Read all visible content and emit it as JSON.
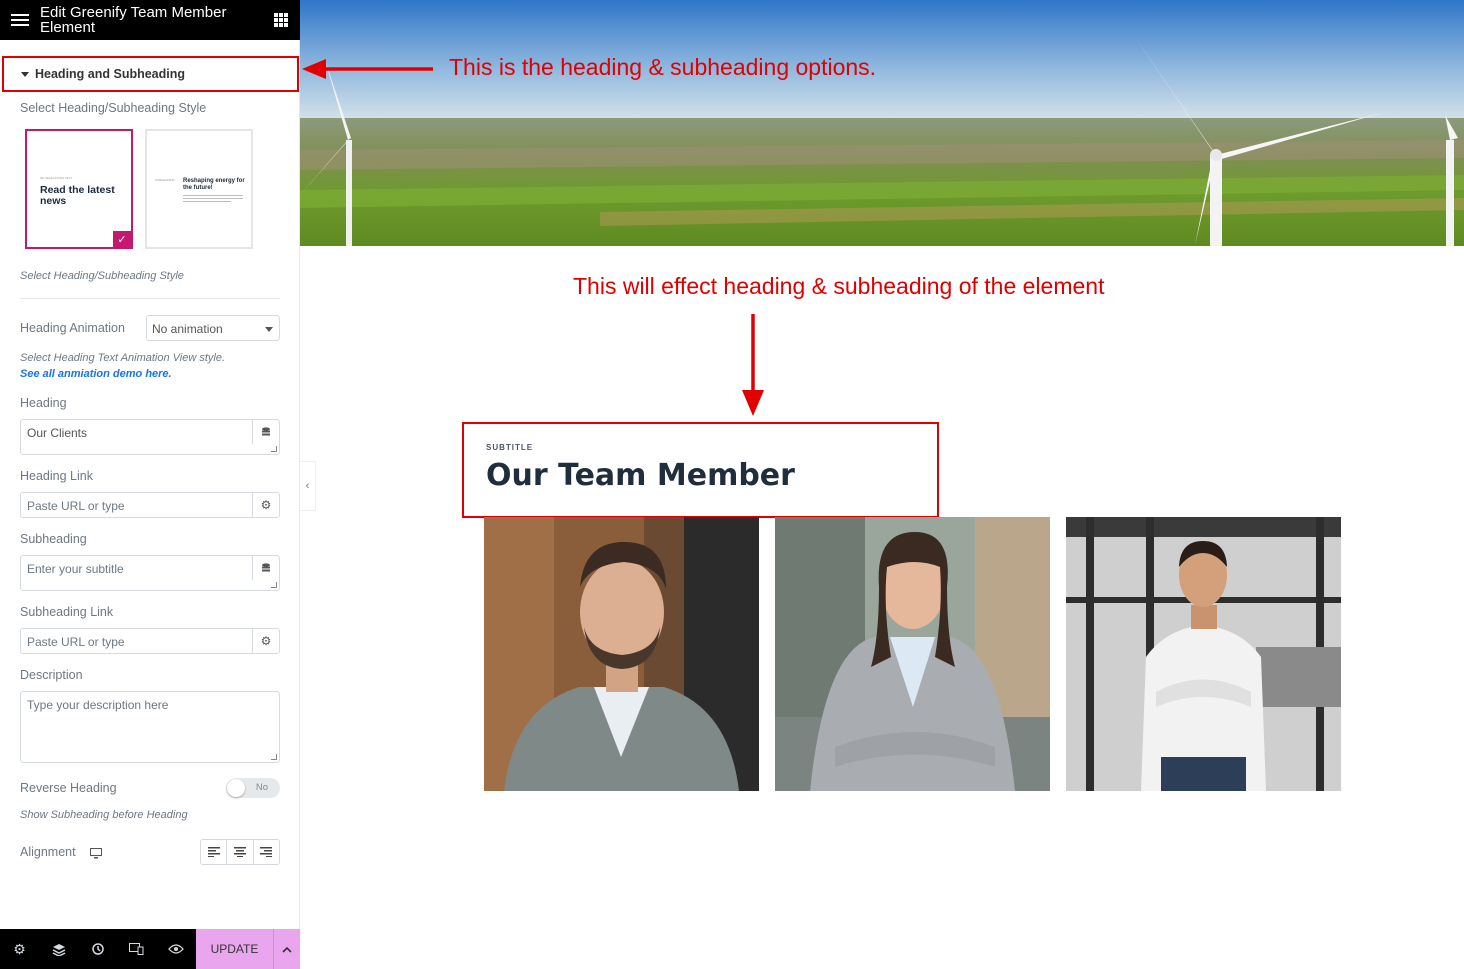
{
  "panel": {
    "title": "Edit Greenify Team Member Element",
    "section_title": "Heading and Subheading",
    "style_label": "Select Heading/Subheading Style",
    "style_hint": "Select Heading/Subheading Style",
    "style_options": [
      {
        "small": "DE SELECTIONS TEXT",
        "big": "Read the latest news"
      },
      {
        "small": "SUBHEADING",
        "big": "Reshaping energy for the future!"
      }
    ],
    "heading_animation_label": "Heading Animation",
    "heading_animation_value": "No animation",
    "animation_hint": "Select Heading Text Animation View style.",
    "animation_demo_link": "See all anmiation demo here.",
    "heading_label": "Heading",
    "heading_value": "Our Clients",
    "heading_link_label": "Heading Link",
    "heading_link_placeholder": "Paste URL or type",
    "subheading_label": "Subheading",
    "subheading_placeholder": "Enter your subtitle",
    "subheading_link_label": "Subheading Link",
    "subheading_link_placeholder": "Paste URL or type",
    "description_label": "Description",
    "description_placeholder": "Type your description here",
    "reverse_heading_label": "Reverse Heading",
    "reverse_heading_value": "No",
    "reverse_hint": "Show Subheading before Heading",
    "alignment_label": "Alignment",
    "update_label": "UPDATE"
  },
  "annotations": {
    "top_note": "This is the heading & subheading options.",
    "middle_note": "This will effect heading & subheading of the element"
  },
  "preview": {
    "subtitle": "SUBTITLE",
    "heading": "Our Team Member",
    "photos": [
      "team-member-man-beard",
      "team-member-woman",
      "team-member-man-white-shirt"
    ]
  },
  "colors": {
    "accent": "#c4176e",
    "annotation_red": "#e00000",
    "update_bg": "#e9a6ef",
    "topbar_bg": "#000000"
  }
}
